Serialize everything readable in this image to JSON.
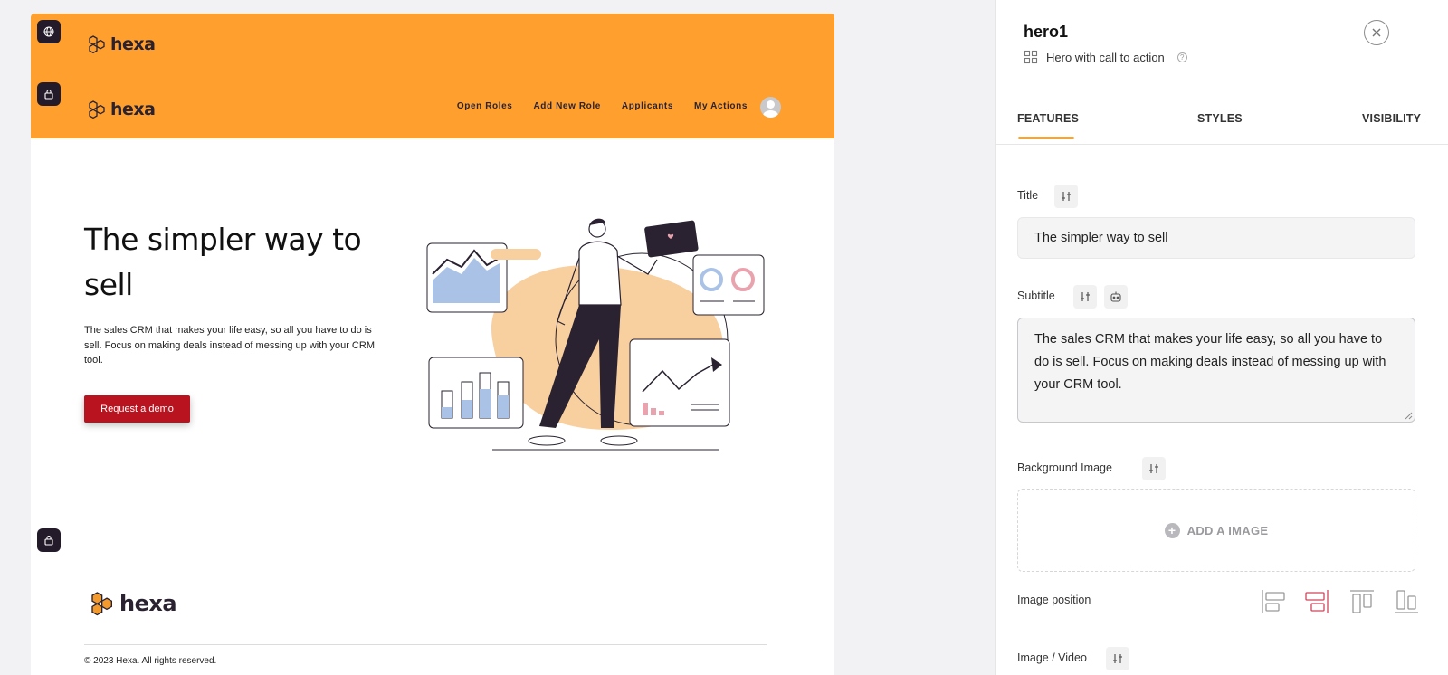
{
  "canvas": {
    "top_logo_text": "hexa",
    "header_logo_text": "hexa",
    "nav": [
      "Open Roles",
      "Add New Role",
      "Applicants",
      "My Actions"
    ],
    "hero": {
      "title": "The simpler way to sell",
      "subtitle": "The sales CRM that makes your life easy, so all you have to do is sell. Focus on making deals instead of messing up with your CRM tool.",
      "cta": "Request a demo"
    },
    "footer_logo_text": "hexa",
    "footer_copy": "© 2023 Hexa. All rights reserved.",
    "colors": {
      "header": "#ff9f2e",
      "cta": "#b8131f",
      "logo_hex": "#f29a2e"
    }
  },
  "side_icons": [
    "globe-icon",
    "lock-icon",
    "lock-icon"
  ],
  "panel": {
    "block_name": "hero1",
    "block_type": "Hero with call to action",
    "tabs": [
      "FEATURES",
      "STYLES",
      "VISIBILITY"
    ],
    "active_tab": "FEATURES",
    "fields": {
      "title_label": "Title",
      "title_value": "The simpler way to sell",
      "subtitle_label": "Subtitle",
      "subtitle_value": "The sales CRM that makes your life easy, so all you have to do is sell. Focus on making deals instead of messing up with your CRM tool.",
      "background_label": "Background Image",
      "add_image": "ADD A IMAGE",
      "image_position_label": "Image position",
      "image_video_label": "Image / Video"
    },
    "image_position_options": [
      "left",
      "right",
      "top",
      "bottom"
    ],
    "image_position_selected": "right",
    "colors": {
      "tab_underline": "#f0a63c",
      "selected_position": "#d0455a"
    }
  }
}
